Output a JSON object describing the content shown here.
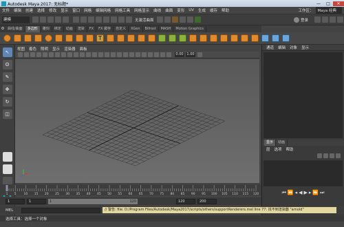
{
  "window": {
    "title": "Autodesk Maya 2017: 无标题*",
    "controls": [
      "—",
      "□",
      "✕"
    ]
  },
  "menubar": {
    "items": [
      "文件",
      "编辑",
      "创建",
      "选择",
      "修改",
      "显示",
      "窗口",
      "网格",
      "编辑网格",
      "网格工具",
      "网格显示",
      "曲线",
      "曲面",
      "变形",
      "UV",
      "生成",
      "缓存",
      "帮助"
    ],
    "workspace_label": "工作区：",
    "workspace_value": "Maya 经典"
  },
  "statusline": {
    "mode": "建模",
    "no_live_surface": "无激活曲面",
    "login": "登录"
  },
  "shelf": {
    "tabs": [
      "曲线/曲面",
      "多边形",
      "雕刻",
      "绑定",
      "动画",
      "渲染",
      "FX",
      "FX 缓存",
      "自定义",
      "XGen",
      "Bifrost",
      "MASH",
      "Motion Graphics"
    ],
    "active_tab": "多边形"
  },
  "viewport": {
    "menus": [
      "视图",
      "着色",
      "照明",
      "显示",
      "渲染器",
      "面板"
    ]
  },
  "channelbox": {
    "menus": [
      "通道",
      "编辑",
      "对象",
      "显示"
    ]
  },
  "layers": {
    "tabs": [
      "显示",
      "动画"
    ],
    "menus": [
      "层",
      "选项",
      "帮助"
    ]
  },
  "timeslider": {
    "ticks": [
      "1",
      "5",
      "10",
      "15",
      "20",
      "25",
      "30",
      "35",
      "40",
      "45",
      "50",
      "55",
      "60",
      "65",
      "70",
      "75",
      "80",
      "85",
      "90",
      "95",
      "100",
      "105",
      "110",
      "115",
      "120"
    ],
    "current_frame": "1"
  },
  "rangeslider": {
    "start": "1",
    "inner_start": "1",
    "inner_end": "120",
    "end": "120",
    "outer_end": "200"
  },
  "cmdline": {
    "label": "MEL",
    "warning": "// 警告: file: D:/Program Files/Autodesk/Maya2017/scripts/others/supportRenderers.mel line 77: 找不到渲染器 \"arnold\"",
    "help": "选择工具：选择一个对象"
  }
}
